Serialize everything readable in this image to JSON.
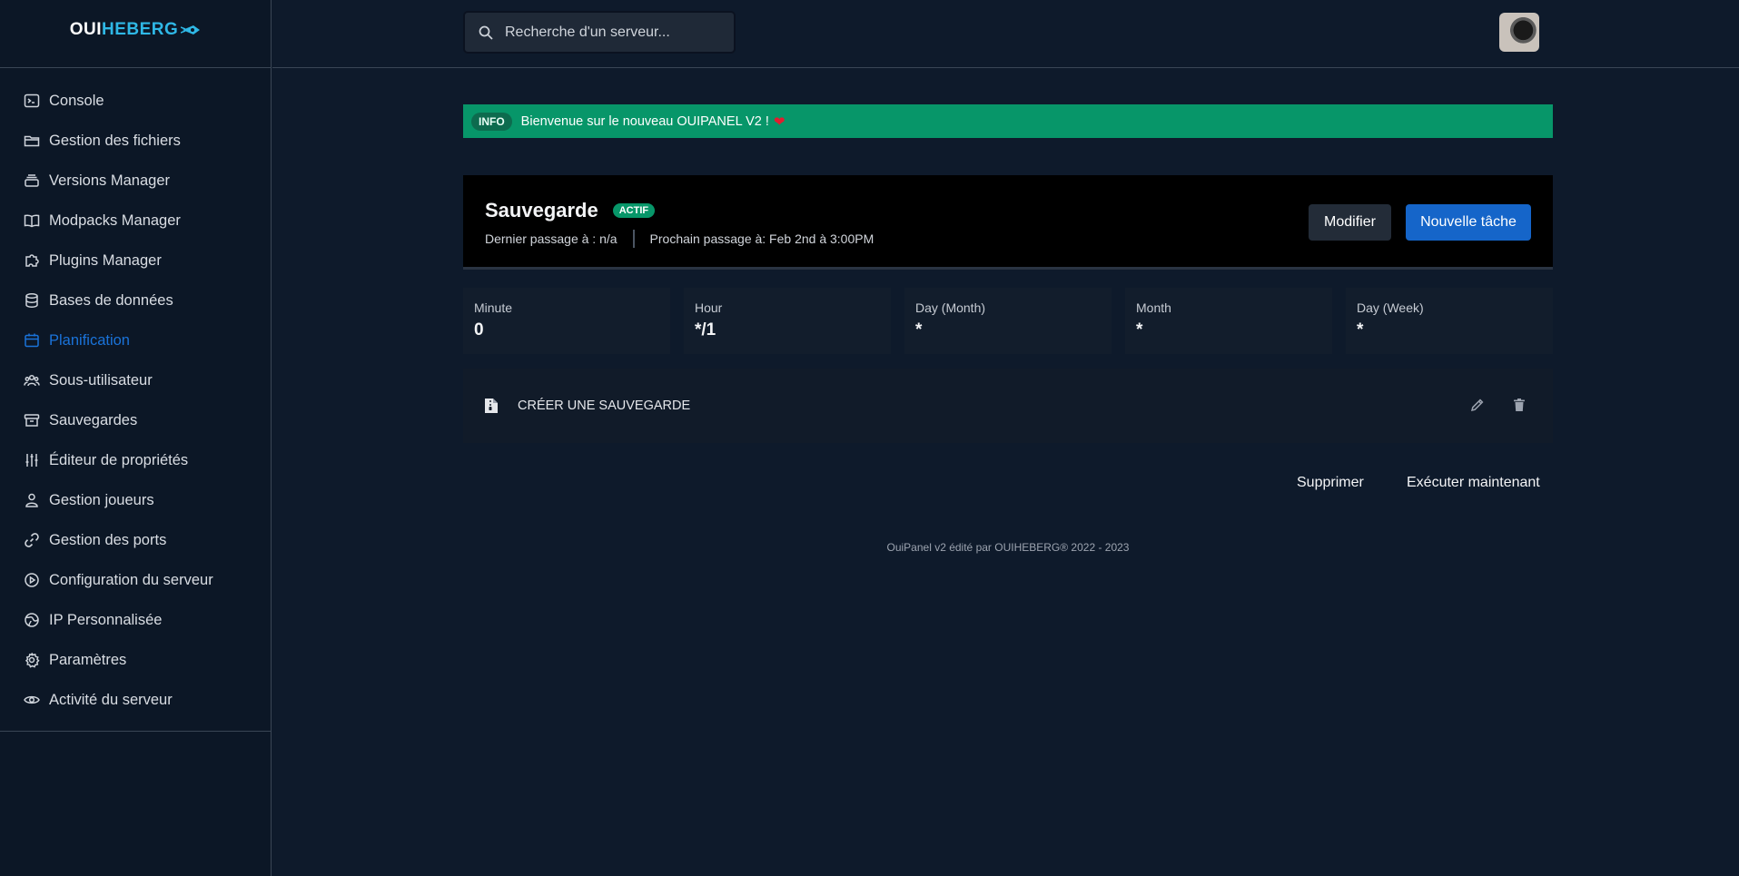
{
  "brand": {
    "part1": "OUI",
    "part2": "HEBERG"
  },
  "sidebar": {
    "items": [
      {
        "label": "Console",
        "icon": "terminal-icon"
      },
      {
        "label": "Gestion des fichiers",
        "icon": "folder-icon"
      },
      {
        "label": "Versions Manager",
        "icon": "layers-icon"
      },
      {
        "label": "Modpacks Manager",
        "icon": "book-icon"
      },
      {
        "label": "Plugins Manager",
        "icon": "puzzle-icon"
      },
      {
        "label": "Bases de données",
        "icon": "database-icon"
      },
      {
        "label": "Planification",
        "icon": "calendar-icon",
        "active": true
      },
      {
        "label": "Sous-utilisateur",
        "icon": "users-icon"
      },
      {
        "label": "Sauvegardes",
        "icon": "archive-icon"
      },
      {
        "label": "Éditeur de propriétés",
        "icon": "sliders-icon"
      },
      {
        "label": "Gestion joueurs",
        "icon": "user-icon"
      },
      {
        "label": "Gestion des ports",
        "icon": "link-icon"
      },
      {
        "label": "Configuration du serveur",
        "icon": "play-circle-icon"
      },
      {
        "label": "IP Personnalisée",
        "icon": "globe-icon"
      },
      {
        "label": "Paramètres",
        "icon": "gear-icon"
      },
      {
        "label": "Activité du serveur",
        "icon": "eye-icon"
      }
    ]
  },
  "search": {
    "placeholder": "Recherche d'un serveur..."
  },
  "info": {
    "badge": "INFO",
    "message": "Bienvenue sur le nouveau OUIPANEL V2 !",
    "heart": "❤"
  },
  "task": {
    "title": "Sauvegarde",
    "status": "ACTIF",
    "last_run": "Dernier passage à : n/a",
    "next_run": "Prochain passage à: Feb 2nd à 3:00PM",
    "modify_label": "Modifier",
    "new_task_label": "Nouvelle tâche"
  },
  "cron": [
    {
      "label": "Minute",
      "value": "0"
    },
    {
      "label": "Hour",
      "value": "*/1"
    },
    {
      "label": "Day (Month)",
      "value": "*"
    },
    {
      "label": "Month",
      "value": "*"
    },
    {
      "label": "Day (Week)",
      "value": "*"
    }
  ],
  "task_item": {
    "name": "CRÉER UNE SAUVEGARDE"
  },
  "actions": {
    "delete_label": "Supprimer",
    "run_label": "Exécuter maintenant"
  },
  "footer": "OuiPanel v2 édité par OUIHEBERG® 2022 - 2023",
  "colors": {
    "accent": "#1a73d9",
    "success": "#079669",
    "background": "#0e1a2b"
  }
}
